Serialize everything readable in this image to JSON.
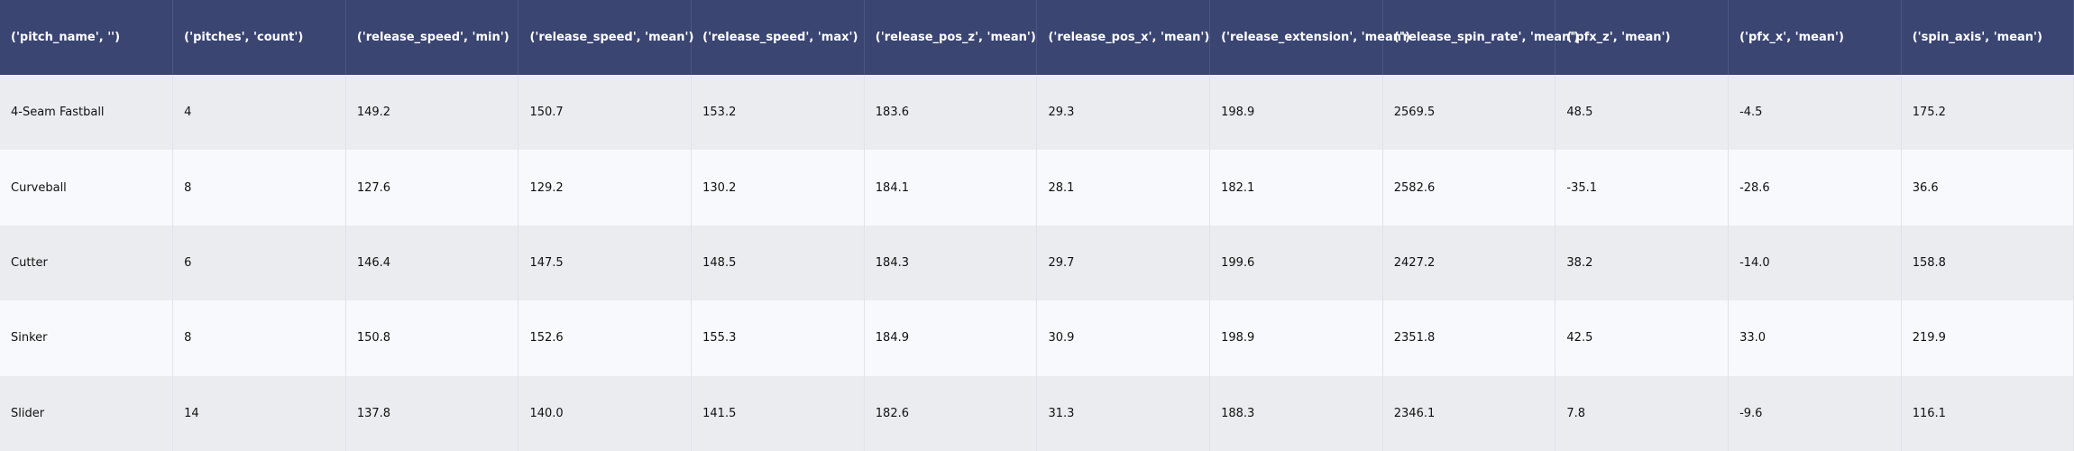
{
  "table": {
    "columns": [
      "('pitch_name', '')",
      "('pitches', 'count')",
      "('release_speed', 'min')",
      "('release_speed', 'mean')",
      "('release_speed', 'max')",
      "('release_pos_z', 'mean')",
      "('release_pos_x', 'mean')",
      "('release_extension', 'mean')",
      "('release_spin_rate', 'mean')",
      "('pfx_z', 'mean')",
      "('pfx_x', 'mean')",
      "('spin_axis', 'mean')"
    ],
    "rows": [
      [
        "4-Seam Fastball",
        "4",
        "149.2",
        "150.7",
        "153.2",
        "183.6",
        "29.3",
        "198.9",
        "2569.5",
        "48.5",
        "-4.5",
        "175.2"
      ],
      [
        "Curveball",
        "8",
        "127.6",
        "129.2",
        "130.2",
        "184.1",
        "28.1",
        "182.1",
        "2582.6",
        "-35.1",
        "-28.6",
        "36.6"
      ],
      [
        "Cutter",
        "6",
        "146.4",
        "147.5",
        "148.5",
        "184.3",
        "29.7",
        "199.6",
        "2427.2",
        "38.2",
        "-14.0",
        "158.8"
      ],
      [
        "Sinker",
        "8",
        "150.8",
        "152.6",
        "155.3",
        "184.9",
        "30.9",
        "198.9",
        "2351.8",
        "42.5",
        "33.0",
        "219.9"
      ],
      [
        "Slider",
        "14",
        "137.8",
        "140.0",
        "141.5",
        "182.6",
        "31.3",
        "188.3",
        "2346.1",
        "7.8",
        "-9.6",
        "116.1"
      ]
    ]
  },
  "colors": {
    "header_background": "#3b4572",
    "header_text": "#ffffff",
    "row_odd": "#ebecf0",
    "row_even": "#f8f9fc"
  }
}
